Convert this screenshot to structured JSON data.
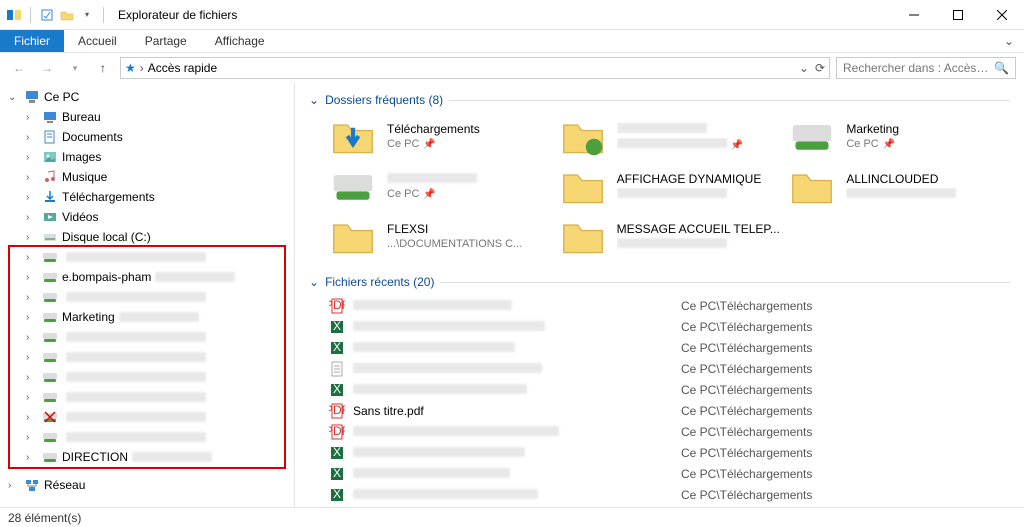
{
  "window": {
    "title": "Explorateur de fichiers"
  },
  "ribbon": {
    "file": "Fichier",
    "tabs": [
      "Accueil",
      "Partage",
      "Affichage"
    ]
  },
  "breadcrumb": {
    "root": "Accès rapide"
  },
  "search": {
    "placeholder": "Rechercher dans : Accès rapide"
  },
  "tree": {
    "thispc": "Ce PC",
    "nodes": [
      {
        "label": "Bureau",
        "icon": "desktop"
      },
      {
        "label": "Documents",
        "icon": "docs"
      },
      {
        "label": "Images",
        "icon": "images"
      },
      {
        "label": "Musique",
        "icon": "music"
      },
      {
        "label": "Téléchargements",
        "icon": "downloads"
      },
      {
        "label": "Vidéos",
        "icon": "videos"
      },
      {
        "label": "Disque local (C:)",
        "icon": "disk"
      }
    ],
    "drives": [
      {
        "label": "",
        "icon": "netdrive"
      },
      {
        "label": "e.bompais-pham",
        "icon": "netdrive"
      },
      {
        "label": "",
        "icon": "netdrive"
      },
      {
        "label": "Marketing",
        "icon": "netdrive"
      },
      {
        "label": "",
        "icon": "netdrive"
      },
      {
        "label": "",
        "icon": "netdrive"
      },
      {
        "label": "",
        "icon": "netdrive"
      },
      {
        "label": "",
        "icon": "netdrive"
      },
      {
        "label": "",
        "icon": "netdrive-x"
      },
      {
        "label": "",
        "icon": "netdrive"
      },
      {
        "label": "DIRECTION",
        "icon": "netdrive"
      }
    ],
    "network": "Réseau"
  },
  "frequent": {
    "title": "Dossiers fréquents",
    "count": 8,
    "items": [
      {
        "name": "Téléchargements",
        "sub": "Ce PC",
        "icon": "downloads-big",
        "pinned": true
      },
      {
        "name": "",
        "sub": "",
        "icon": "folder-share",
        "pinned": true
      },
      {
        "name": "Marketing",
        "sub": "Ce PC",
        "icon": "netdrive-big",
        "pinned": true
      },
      {
        "name": "",
        "sub": "Ce PC",
        "icon": "netdrive-big",
        "pinned": true
      },
      {
        "name": "AFFICHAGE DYNAMIQUE",
        "sub": "",
        "icon": "folder"
      },
      {
        "name": "ALLINCLOUDED",
        "sub": "",
        "icon": "folder"
      },
      {
        "name": "FLEXSI",
        "sub": "...\\DOCUMENTATIONS C...",
        "icon": "folder"
      },
      {
        "name": "MESSAGE ACCUEIL TELEP...",
        "sub": "",
        "icon": "folder"
      }
    ]
  },
  "recent": {
    "title": "Fichiers récents",
    "count": 20,
    "path_common": "Ce PC\\Téléchargements",
    "items": [
      {
        "icon": "pdf",
        "name": ""
      },
      {
        "icon": "excel",
        "name": ""
      },
      {
        "icon": "excel",
        "name": ""
      },
      {
        "icon": "text",
        "name": ""
      },
      {
        "icon": "excel",
        "name": ""
      },
      {
        "icon": "pdf",
        "name": "Sans titre.pdf"
      },
      {
        "icon": "pdf",
        "name": ""
      },
      {
        "icon": "excel",
        "name": ""
      },
      {
        "icon": "excel",
        "name": ""
      },
      {
        "icon": "excel",
        "name": ""
      }
    ]
  },
  "status": {
    "text": "28 élément(s)"
  }
}
